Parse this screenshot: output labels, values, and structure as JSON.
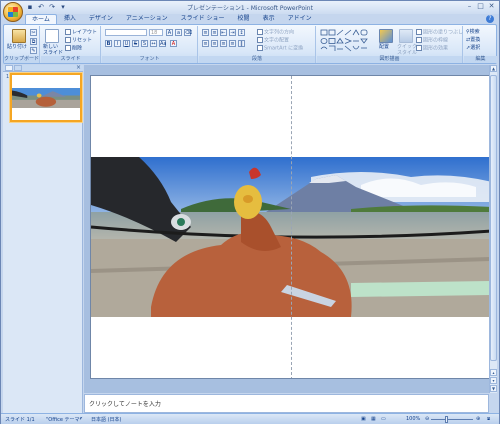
{
  "window": {
    "title": "プレゼンテーション1 - Microsoft PowerPoint"
  },
  "tabs": [
    "ホーム",
    "挿入",
    "デザイン",
    "アニメーション",
    "スライド ショー",
    "校閲",
    "表示",
    "アドイン"
  ],
  "ribbon": {
    "clipboard": {
      "paste": "貼り付け",
      "label": "クリップボード"
    },
    "slides": {
      "new_slide": "新しい\nスライド",
      "layout": "レイアウト",
      "reset": "リセット",
      "delete": "削除",
      "label": "スライド"
    },
    "font": {
      "label": "フォント",
      "size": "18"
    },
    "paragraph": {
      "label": "段落",
      "text_direction": "文字列の方向",
      "align_text": "文字の配置",
      "smartart": "SmartArt に変換"
    },
    "drawing": {
      "arrange": "配置",
      "quick_styles": "クイック\nスタイル",
      "shape_fill": "図形の塗りつぶし",
      "shape_outline": "図形の枠線",
      "shape_effects": "図形の効果",
      "label": "図形描画"
    },
    "editing": {
      "find": "検索",
      "replace": "置換",
      "select": "選択",
      "label": "編集"
    }
  },
  "slides_pane": {
    "slide_number": "1"
  },
  "notes": {
    "placeholder": "クリックしてノートを入力"
  },
  "status": {
    "slide": "スライド 1/1",
    "theme": "\"Office テーマ\"",
    "language": "日本語 (日本)",
    "zoom": "100%"
  },
  "colors": {
    "accent": "#f5a623",
    "ribbon": "#dbe8f8",
    "frame": "#c5d6ee"
  }
}
